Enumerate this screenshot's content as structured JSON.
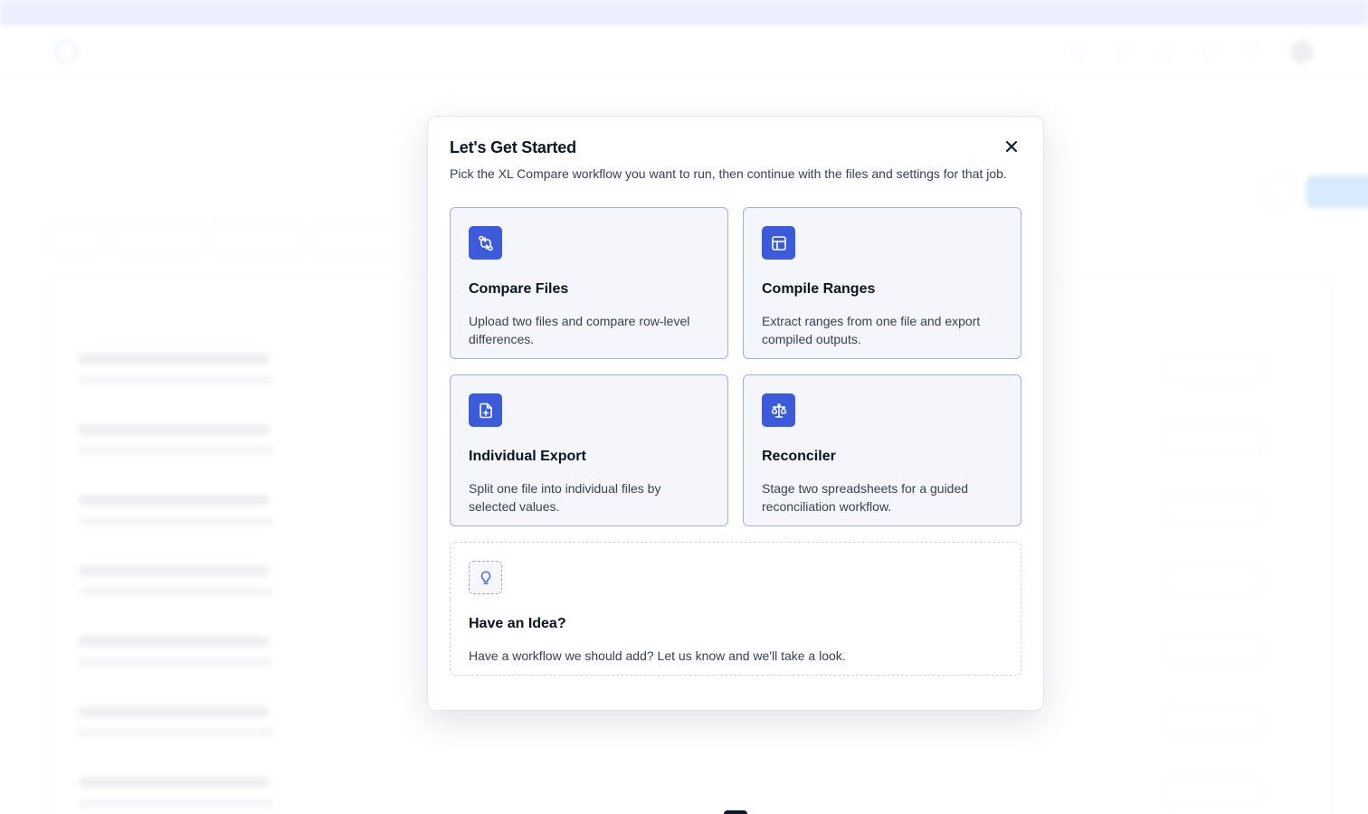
{
  "modal": {
    "title": "Let's Get Started",
    "description": "Pick the XL Compare workflow you want to run, then continue with the files and settings for that job.",
    "close_icon": "close-icon",
    "options": [
      {
        "title": "Compare Files",
        "description": "Upload two files and compare row-level differences.",
        "icon": "compare-arrows-icon"
      },
      {
        "title": "Compile Ranges",
        "description": "Extract ranges from one file and export compiled outputs.",
        "icon": "table-icon"
      },
      {
        "title": "Individual Export",
        "description": "Split one file into individual files by selected values.",
        "icon": "file-plus-icon"
      },
      {
        "title": "Reconciler",
        "description": "Stage two spreadsheets for a guided reconciliation workflow.",
        "icon": "scale-icon"
      }
    ],
    "idea": {
      "title": "Have an Idea?",
      "description": "Have a workflow we should add? Let us know and we'll take a look.",
      "icon": "lightbulb-icon"
    }
  },
  "colors": {
    "accent": "#3b5bdb",
    "card_border": "#9fb0e6",
    "card_bg": "#f4f6fb"
  }
}
